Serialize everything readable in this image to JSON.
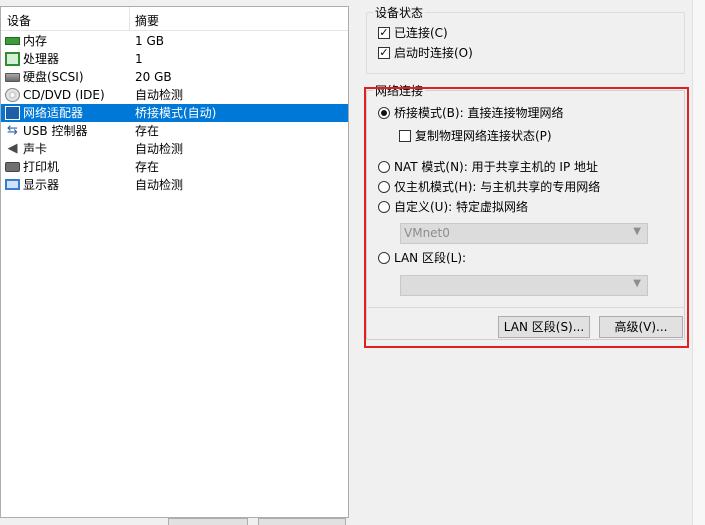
{
  "device_list": {
    "col_device": "设备",
    "col_summary": "摘要",
    "rows": [
      {
        "name": "内存",
        "summary": "1 GB",
        "icon": "memory-icon"
      },
      {
        "name": "处理器",
        "summary": "1",
        "icon": "processor-icon"
      },
      {
        "name": "硬盘(SCSI)",
        "summary": "20 GB",
        "icon": "hard-disk-icon"
      },
      {
        "name": "CD/DVD (IDE)",
        "summary": "自动检测",
        "icon": "cd-dvd-icon"
      },
      {
        "name": "网络适配器",
        "summary": "桥接模式(自动)",
        "icon": "network-adapter-icon"
      },
      {
        "name": "USB 控制器",
        "summary": "存在",
        "icon": "usb-icon"
      },
      {
        "name": "声卡",
        "summary": "自动检测",
        "icon": "sound-card-icon"
      },
      {
        "name": "打印机",
        "summary": "存在",
        "icon": "printer-icon"
      },
      {
        "name": "显示器",
        "summary": "自动检测",
        "icon": "display-icon"
      }
    ]
  },
  "device_status": {
    "title": "设备状态",
    "connected": "已连接(C)",
    "connect_on_power": "启动时连接(O)"
  },
  "network": {
    "title": "网络连接",
    "bridged": "桥接模式(B): 直接连接物理网络",
    "replicate_state": "复制物理网络连接状态(P)",
    "nat": "NAT 模式(N): 用于共享主机的 IP 地址",
    "host_only": "仅主机模式(H): 与主机共享的专用网络",
    "custom": "自定义(U): 特定虚拟网络",
    "custom_value": "VMnet0",
    "lan_segment": "LAN 区段(L):",
    "lan_value": "",
    "lan_button": "LAN 区段(S)...",
    "advanced_button": "高级(V)..."
  },
  "colors": {
    "selection": "#0078d7",
    "highlight": "#e02020"
  }
}
